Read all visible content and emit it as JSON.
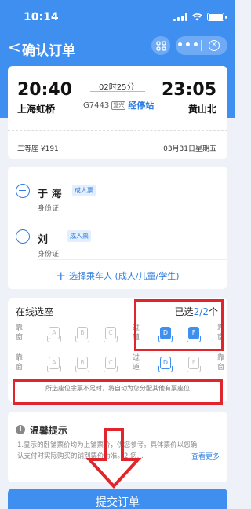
{
  "status_bar": {
    "time": "10:14"
  },
  "nav": {
    "back_glyph": "<",
    "title": "确认订单",
    "scan_icon": "scan-icon",
    "more_glyph": "•••",
    "close_glyph": "×"
  },
  "train": {
    "dep_time": "20:40",
    "dep_station": "上海虹桥",
    "arr_time": "23:05",
    "arr_station": "黄山北",
    "duration": "02时25分",
    "train_no": "G7443",
    "train_tag": "复兴",
    "via_label": "经停站",
    "seat_type": "二等座 ¥191",
    "date": "03月31日星期五"
  },
  "passengers": [
    {
      "name": "于  海",
      "type": "成人票",
      "id_label": "身份证",
      "id_value": ""
    },
    {
      "name": "刘",
      "type": "成人票",
      "id_label": "身份证",
      "id_value": ""
    }
  ],
  "add_passenger": {
    "plus": "+",
    "label": "选择乘车人 (成人/儿童/学生)"
  },
  "seat_selection": {
    "title": "在线选座",
    "selected_prefix": "已选",
    "selected_count": "2/2",
    "selected_suffix": "个",
    "window_label": "靠窗",
    "aisle_label": "过道",
    "letters": [
      "A",
      "B",
      "C",
      "D",
      "F"
    ],
    "row1_selected": [
      "D",
      "F"
    ],
    "note": "所选座位余票不足时，将自动为您分配其他有票座位"
  },
  "tips": {
    "icon_glyph": "i",
    "title": "温馨提示",
    "text1": "1.显示的卧铺票价均为上铺票价，供您参考。具体票价以您确",
    "text2": "认支付时实际购买的铺别票价为准。2.您...",
    "see_more": "查看更多"
  },
  "submit_label": "提交订单",
  "colors": {
    "header_blue": "#3e8ff0",
    "accent": "#2f7de1",
    "annotation_red": "#e0262c"
  }
}
